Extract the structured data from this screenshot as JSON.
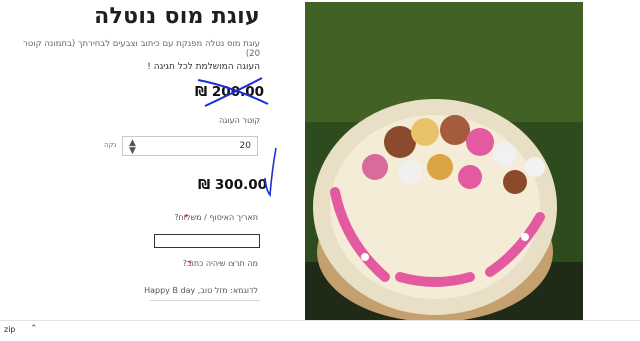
{
  "product": {
    "title": "עוגת מוס נוטלה",
    "subtitle": "עוגת מוס נטלה מפנקת עם כיתוב וצבעים לבחירתך (בתמונה קוטר 20)",
    "promo": "העוגה המושלמת לכל חגיגה !",
    "old_price": "₪ 200.00",
    "new_price": "₪ 300.00"
  },
  "options": {
    "size_label": "קוטר העוגה",
    "size_value": "20",
    "size_side_label": "נקה",
    "date_label": "תאריך האיסוף / משלוח?",
    "date_value": "",
    "message_label": "מה תרצו שיהיה כתוב?",
    "message_placeholder": "לדוגמא: מזל טוב, Happy B day"
  },
  "photo": {
    "alt": "עוגת מוס עם כיתוב מזל טוב"
  },
  "download_bar": {
    "item": "zip",
    "icon": "chevron-up-icon"
  },
  "colors": {
    "accent_annotation": "#1a2fd6",
    "cake_pink": "#e45aa0",
    "cake_cream": "#f4ecd6"
  }
}
